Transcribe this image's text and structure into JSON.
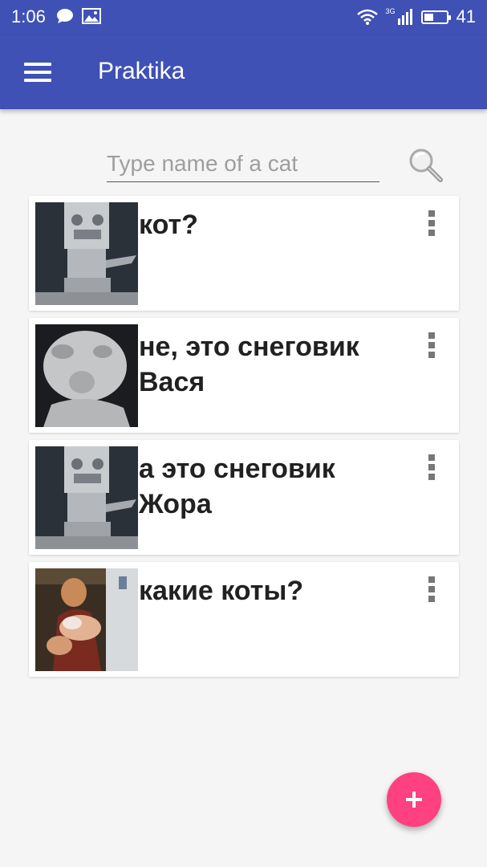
{
  "status": {
    "time": "1:06",
    "battery": "41",
    "network_label": "3G",
    "battery_level": 0.41,
    "icons": [
      "message-icon",
      "image-icon",
      "wifi-icon",
      "signal-icon",
      "battery-icon"
    ]
  },
  "appbar": {
    "title": "Praktika",
    "menu_icon": "hamburger-icon"
  },
  "search": {
    "placeholder": "Type name of a cat",
    "value": "",
    "icon": "search-icon"
  },
  "cards": [
    {
      "text": "кот?",
      "image": "snowman-robot"
    },
    {
      "text": "не,  это снеговик Вася",
      "image": "snowman-face"
    },
    {
      "text": "а это снеговик Жора",
      "image": "snowman-robot"
    },
    {
      "text": "какие коты?",
      "image": "person-holding-rat"
    }
  ],
  "fab": {
    "icon": "plus-icon"
  },
  "colors": {
    "primary": "#3f51b5",
    "accent": "#ff4081"
  }
}
